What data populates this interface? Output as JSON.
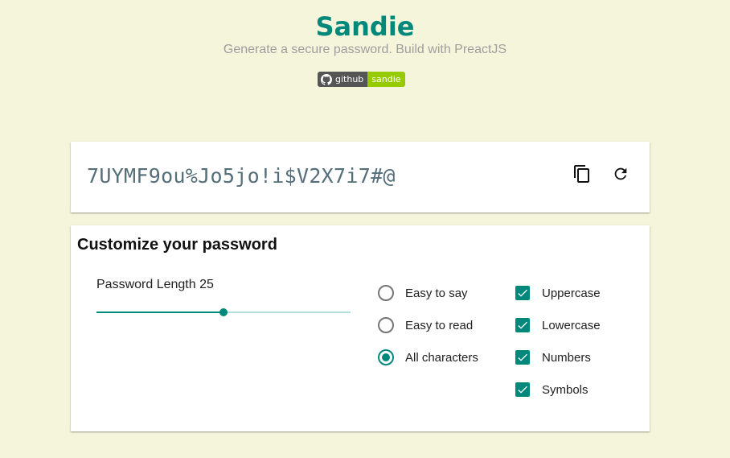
{
  "header": {
    "title": "Sandie",
    "subtitle": "Generate a secure password. Build with PreactJS",
    "badge": {
      "left": "github",
      "right": "sandie",
      "icon": "github-icon"
    }
  },
  "password_card": {
    "password": "7UYMF9ou%Jo5jo!i$V2X7i7#@",
    "copy_icon": "copy-icon",
    "refresh_icon": "refresh-icon"
  },
  "customize": {
    "title": "Customize your password",
    "length_label": "Password Length 25",
    "length": {
      "value": 25,
      "min": 4,
      "max": 46
    },
    "modes": [
      {
        "label": "Easy to say",
        "checked": false
      },
      {
        "label": "Easy to read",
        "checked": false
      },
      {
        "label": "All characters",
        "checked": true
      }
    ],
    "charsets": [
      {
        "label": "Uppercase",
        "checked": true
      },
      {
        "label": "Lowercase",
        "checked": true
      },
      {
        "label": "Numbers",
        "checked": true
      },
      {
        "label": "Symbols",
        "checked": true
      }
    ]
  },
  "colors": {
    "background": "#f5f5dc",
    "accent": "#00897b",
    "badge_green": "#97ca00"
  }
}
